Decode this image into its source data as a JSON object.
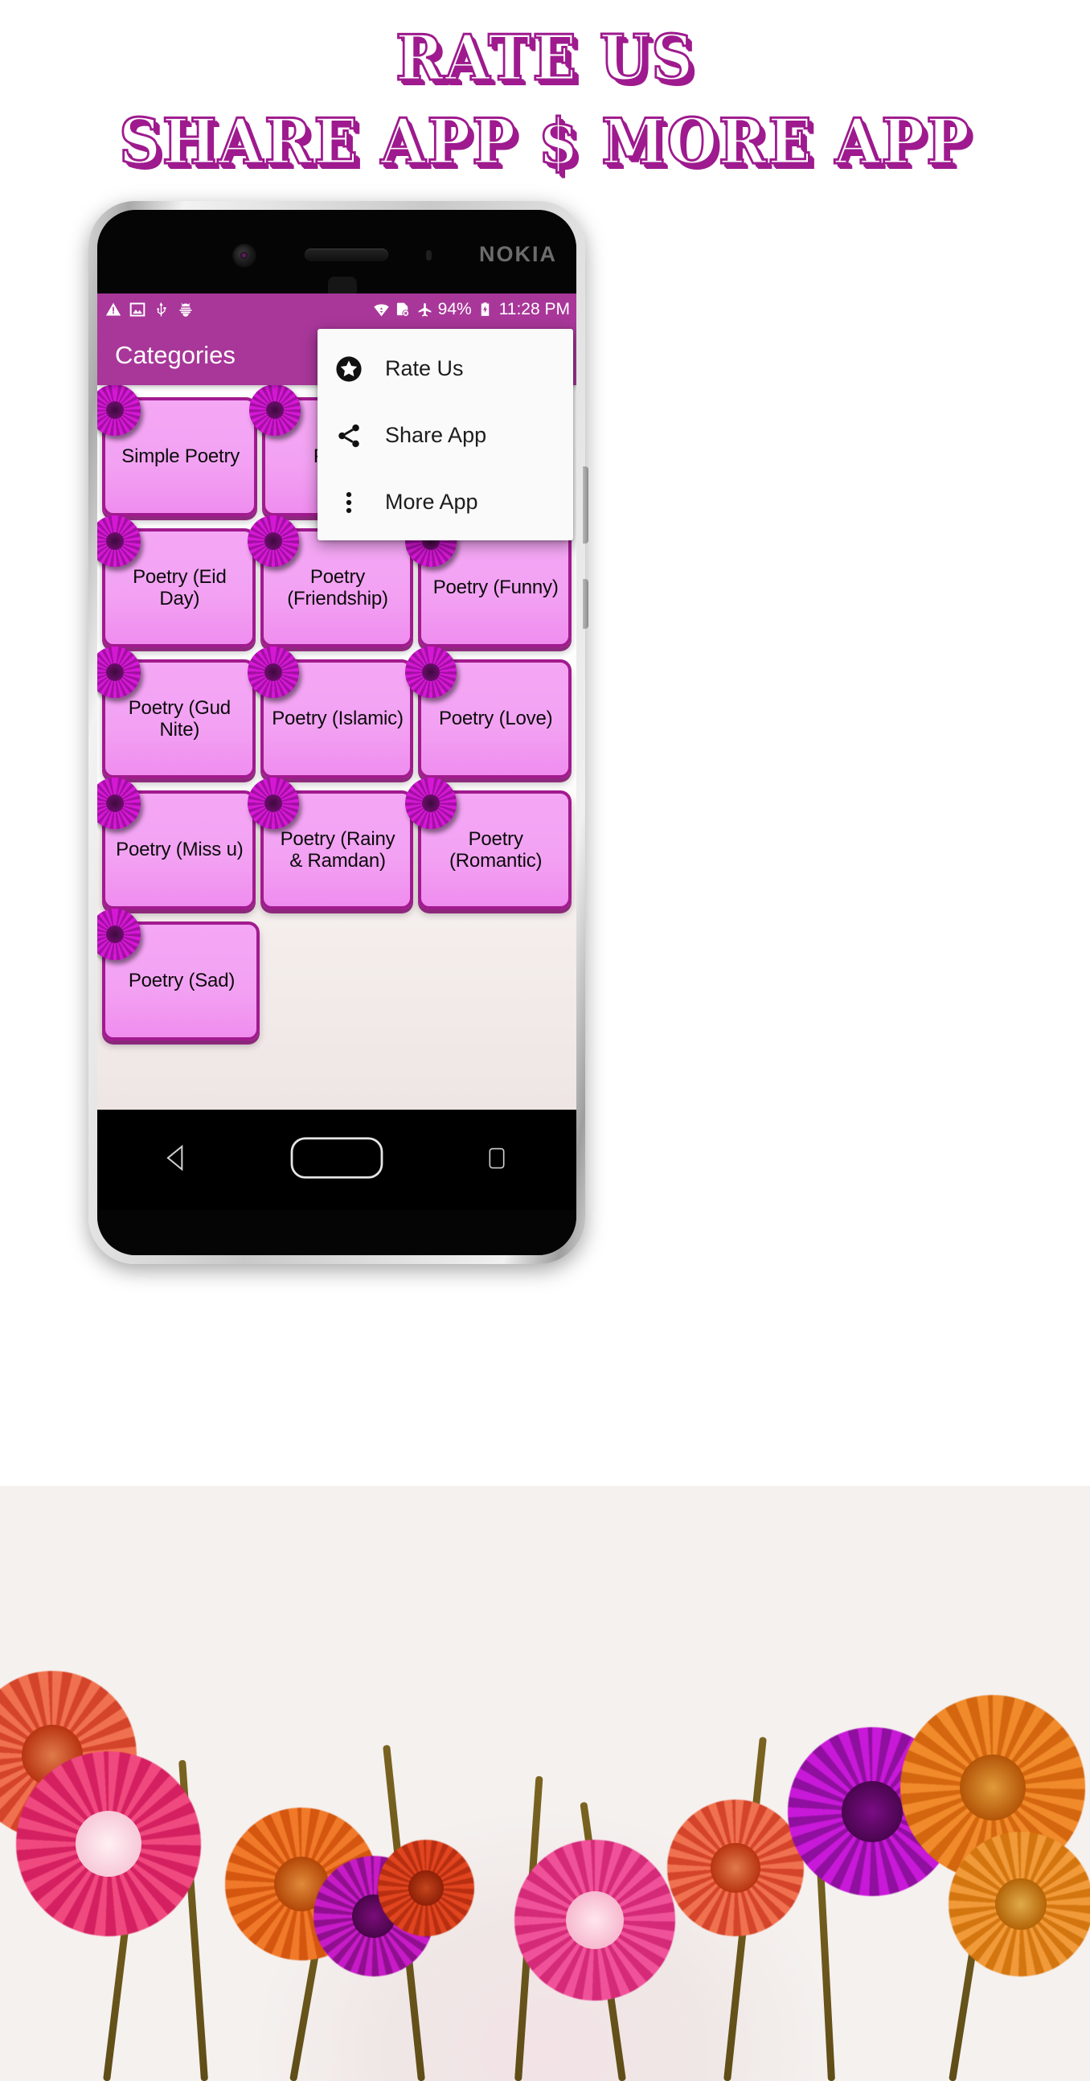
{
  "promo": {
    "line1": "RATE US",
    "line2": "SHARE APP $ MORE APP",
    "accent_color": "#9e1a8e"
  },
  "phone": {
    "brand": "NOKIA",
    "icons": {
      "camera": "front-camera",
      "speaker": "earpiece-speaker",
      "sensor": "proximity-sensor"
    }
  },
  "statusbar": {
    "left_icons": [
      "warning-triangle-icon",
      "image-icon",
      "usb-icon",
      "bug-icon"
    ],
    "right_icons": [
      "wifi-icon",
      "sim-card-error-icon",
      "airplane-mode-icon",
      "battery-charging-icon"
    ],
    "battery_percent": "94%",
    "time": "11:28 PM",
    "background_color": "#a83799"
  },
  "appbar": {
    "title": "Categories",
    "background_color": "#a83799",
    "text_color": "#ffffff"
  },
  "menu": {
    "items": [
      {
        "label": "Rate Us",
        "icon": "star-circle-icon"
      },
      {
        "label": "Share App",
        "icon": "share-icon"
      },
      {
        "label": "More App",
        "icon": "more-vertical-icon"
      }
    ]
  },
  "grid": {
    "tile_border_color": "#a21a8f",
    "tile_fill_color": "#f4a7f4",
    "rows": [
      [
        {
          "label": "Simple Poetry"
        },
        {
          "label": "Poetry"
        },
        {
          "label": ""
        }
      ],
      [
        {
          "label": "Poetry (Eid Day)"
        },
        {
          "label": "Poetry (Friendship)"
        },
        {
          "label": "Poetry (Funny)"
        }
      ],
      [
        {
          "label": "Poetry (Gud Nite)"
        },
        {
          "label": "Poetry (Islamic)"
        },
        {
          "label": "Poetry (Love)"
        }
      ],
      [
        {
          "label": "Poetry (Miss u)"
        },
        {
          "label": "Poetry (Rainy & Ramdan)"
        },
        {
          "label": "Poetry (Romantic)"
        }
      ],
      [
        {
          "label": "Poetry (Sad)"
        },
        {
          "label": ""
        },
        {
          "label": ""
        }
      ]
    ]
  },
  "navbar": {
    "buttons": [
      {
        "name": "back",
        "icon": "back-triangle-icon"
      },
      {
        "name": "home",
        "icon": "home-rounded-rect-icon"
      },
      {
        "name": "recents",
        "icon": "recents-rect-icon"
      }
    ]
  }
}
